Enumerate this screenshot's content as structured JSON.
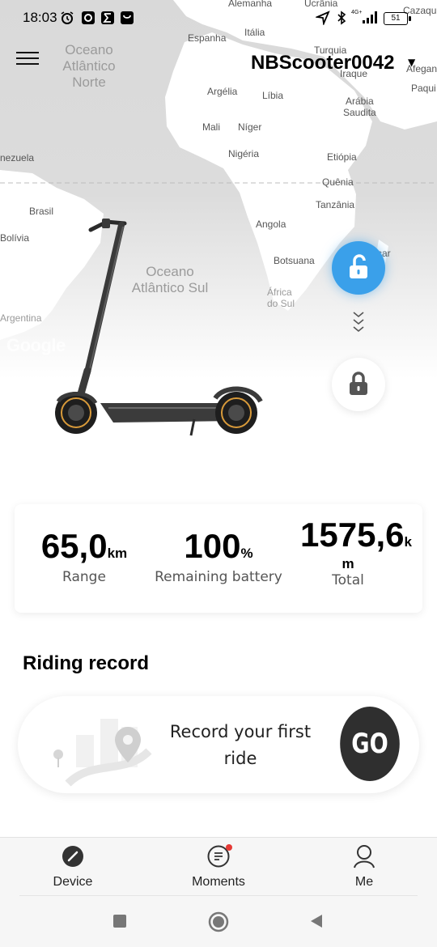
{
  "status_bar": {
    "time": "18:03",
    "battery": "51",
    "network": "4G+"
  },
  "header": {
    "device_name": "NBScooter0042",
    "menu_icon": "hamburger-menu-icon",
    "dropdown_icon": "caret-down-icon"
  },
  "map": {
    "oceans": [
      "Oceano\nAtlântico\nNorte",
      "Oceano\nAtlântico Sul"
    ],
    "labels": [
      "Alemanha",
      "Ucrânia",
      "Cazaqui",
      "Itália",
      "Espanha",
      "Turquia",
      "Iraque",
      "Afegan",
      "Paqui",
      "Argélia",
      "Líbia",
      "Arábia\nSaudita",
      "Mali",
      "Níger",
      "Nigéria",
      "Etiópia",
      "nezuela",
      "Quênia",
      "Brasil",
      "Tanzânia",
      "Bolívia",
      "Angola",
      "Botsuana",
      "África\ndo Sul",
      "car",
      "Argentina"
    ],
    "watermark": "Google"
  },
  "controls": {
    "unlock_icon": "unlock-icon",
    "lock_icon": "lock-icon",
    "arrows_icon": "chevrons-down-icon"
  },
  "stats": [
    {
      "value": "65,0",
      "unit": "km",
      "label": "Range"
    },
    {
      "value": "100",
      "unit": "%",
      "label": "Remaining battery"
    },
    {
      "value": "1575,6",
      "unit": "k",
      "unit2": "m",
      "label": "Total"
    }
  ],
  "riding": {
    "title": "Riding record",
    "prompt": "Record your first ride",
    "go_label": "GO"
  },
  "nav": [
    {
      "label": "Device",
      "icon": "device-icon",
      "active": true
    },
    {
      "label": "Moments",
      "icon": "moments-icon",
      "badge": true
    },
    {
      "label": "Me",
      "icon": "profile-icon"
    }
  ],
  "colors": {
    "accent": "#3aa0ea",
    "go_bg": "#2f2f2f",
    "badge": "#e53935"
  }
}
